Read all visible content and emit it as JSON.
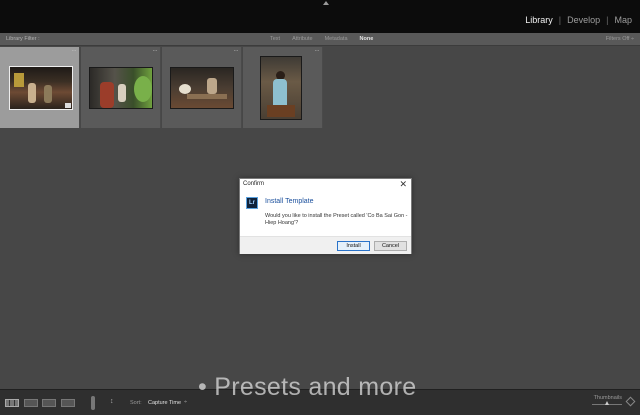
{
  "modules": {
    "library": "Library",
    "develop": "Develop",
    "map": "Map",
    "separator": "|"
  },
  "filter_bar": {
    "label": "Library Filter :",
    "options": [
      "Text",
      "Attribute",
      "Metadata",
      "None"
    ],
    "active_option": "None",
    "filters_off": "Filters Off ÷"
  },
  "grid": {
    "dots": "···",
    "thumbnail_count": 4
  },
  "dialog": {
    "title": "Confirm",
    "close": "✕",
    "icon_text": "Lr",
    "heading": "Install Template",
    "message": "Would you like to install the Preset called 'Co Ba Sai Gon - Hiep Hoang'?",
    "install_label": "Install",
    "cancel_label": "Cancel"
  },
  "toolbar": {
    "sort_label": "Sort:",
    "sort_value": "Capture Time",
    "sort_caret": "÷",
    "sort_dir": "↕",
    "thumbnails_label": "Thumbnails"
  },
  "watermark": "• Presets and more",
  "colors": {
    "accent_blue": "#1a4f9c",
    "background": "#474747",
    "top_bar": "#0c0c0c"
  }
}
